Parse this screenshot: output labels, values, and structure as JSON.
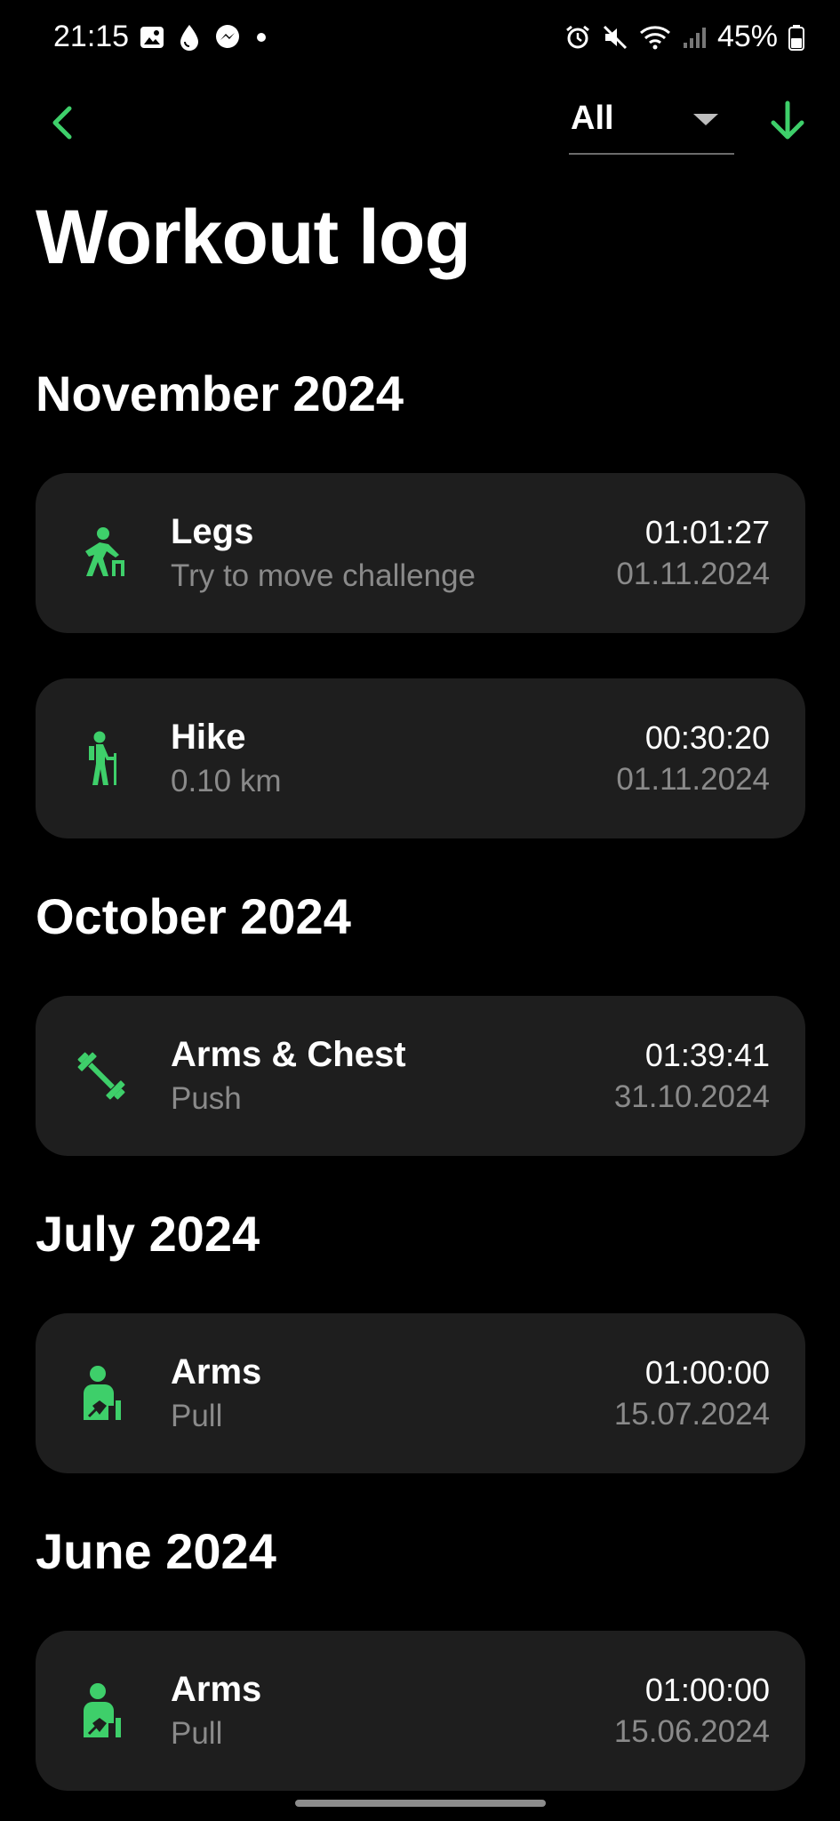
{
  "status_bar": {
    "time": "21:15",
    "battery": "45%",
    "left_icons": [
      "gallery-icon",
      "drop-icon",
      "messenger-icon",
      "dot-icon"
    ],
    "right_icons": [
      "alarm-icon",
      "mute-icon",
      "wifi-icon",
      "signal-icon",
      "battery-icon"
    ]
  },
  "header": {
    "back_icon": "chevron-left-icon",
    "filter_value": "All",
    "download_icon": "arrow-down-icon",
    "accent_color": "#3ecf6a"
  },
  "page_title": "Workout log",
  "sections": [
    {
      "title": "November 2024",
      "items": [
        {
          "icon": "stretching-person-icon",
          "title": "Legs",
          "subtitle": "Try to move challenge",
          "duration": "01:01:27",
          "date": "01.11.2024"
        },
        {
          "icon": "hiker-icon",
          "title": "Hike",
          "subtitle": "0.10 km",
          "duration": "00:30:20",
          "date": "01.11.2024"
        }
      ]
    },
    {
      "title": "October 2024",
      "items": [
        {
          "icon": "dumbbell-icon",
          "title": "Arms & Chest",
          "subtitle": "Push",
          "duration": "01:39:41",
          "date": "31.10.2024"
        }
      ]
    },
    {
      "title": "July 2024",
      "items": [
        {
          "icon": "person-arm-icon",
          "title": "Arms",
          "subtitle": "Pull",
          "duration": "01:00:00",
          "date": "15.07.2024"
        }
      ]
    },
    {
      "title": "June 2024",
      "items": [
        {
          "icon": "person-arm-icon",
          "title": "Arms",
          "subtitle": "Pull",
          "duration": "01:00:00",
          "date": "15.06.2024"
        }
      ]
    }
  ]
}
